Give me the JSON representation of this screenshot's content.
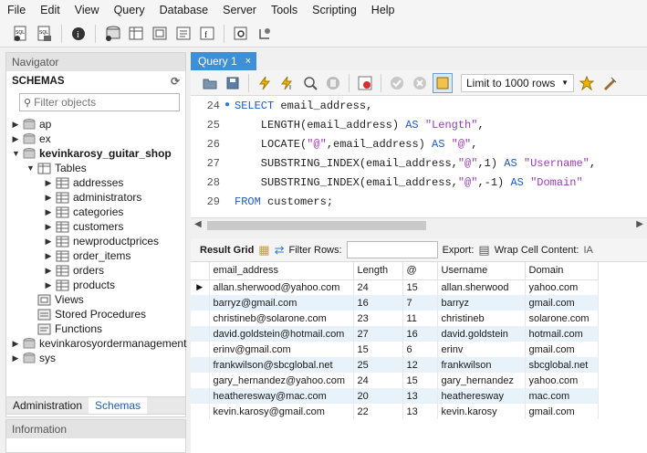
{
  "menu": [
    "File",
    "Edit",
    "View",
    "Query",
    "Database",
    "Server",
    "Tools",
    "Scripting",
    "Help"
  ],
  "navigator": {
    "title": "Navigator",
    "schemas_label": "SCHEMAS",
    "filter_placeholder": "Filter objects",
    "schemas": [
      "ap",
      "ex",
      "kevinkarosy_guitar_shop"
    ],
    "tables_label": "Tables",
    "tables": [
      "addresses",
      "administrators",
      "categories",
      "customers",
      "newproductprices",
      "order_items",
      "orders",
      "products"
    ],
    "views_label": "Views",
    "procs_label": "Stored Procedures",
    "funcs_label": "Functions",
    "other_schemas": [
      "kevinkarosyordermanagement",
      "sys"
    ]
  },
  "nav_tabs": {
    "administration": "Administration",
    "schemas": "Schemas"
  },
  "information": {
    "title": "Information"
  },
  "query_tab": {
    "label": "Query 1",
    "close": "×"
  },
  "editor_toolbar": {
    "limit_label": "Limit to 1000 rows"
  },
  "editor": {
    "line_numbers": [
      "24",
      "25",
      "26",
      "27",
      "28",
      "29"
    ],
    "lines": [
      "SELECT email_address,",
      "LENGTH(email_address) AS \"Length\",",
      "LOCATE(\"@\",email_address) AS \"@\",",
      "SUBSTRING_INDEX(email_address,\"@\",1) AS \"Username\",",
      "SUBSTRING_INDEX(email_address,\"@\",-1) AS \"Domain\"",
      "FROM customers;"
    ]
  },
  "result_toolbar": {
    "result_grid": "Result Grid",
    "filter_rows": "Filter Rows:",
    "export": "Export:",
    "wrap": "Wrap Cell Content:"
  },
  "grid": {
    "columns": [
      "email_address",
      "Length",
      "@",
      "Username",
      "Domain"
    ],
    "rows": [
      [
        "allan.sherwood@yahoo.com",
        "24",
        "15",
        "allan.sherwood",
        "yahoo.com"
      ],
      [
        "barryz@gmail.com",
        "16",
        "7",
        "barryz",
        "gmail.com"
      ],
      [
        "christineb@solarone.com",
        "23",
        "11",
        "christineb",
        "solarone.com"
      ],
      [
        "david.goldstein@hotmail.com",
        "27",
        "16",
        "david.goldstein",
        "hotmail.com"
      ],
      [
        "erinv@gmail.com",
        "15",
        "6",
        "erinv",
        "gmail.com"
      ],
      [
        "frankwilson@sbcglobal.net",
        "25",
        "12",
        "frankwilson",
        "sbcglobal.net"
      ],
      [
        "gary_hernandez@yahoo.com",
        "24",
        "15",
        "gary_hernandez",
        "yahoo.com"
      ],
      [
        "heatheresway@mac.com",
        "20",
        "13",
        "heatheresway",
        "mac.com"
      ],
      [
        "kevin.karosy@gmail.com",
        "22",
        "13",
        "kevin.karosy",
        "gmail.com"
      ]
    ]
  }
}
